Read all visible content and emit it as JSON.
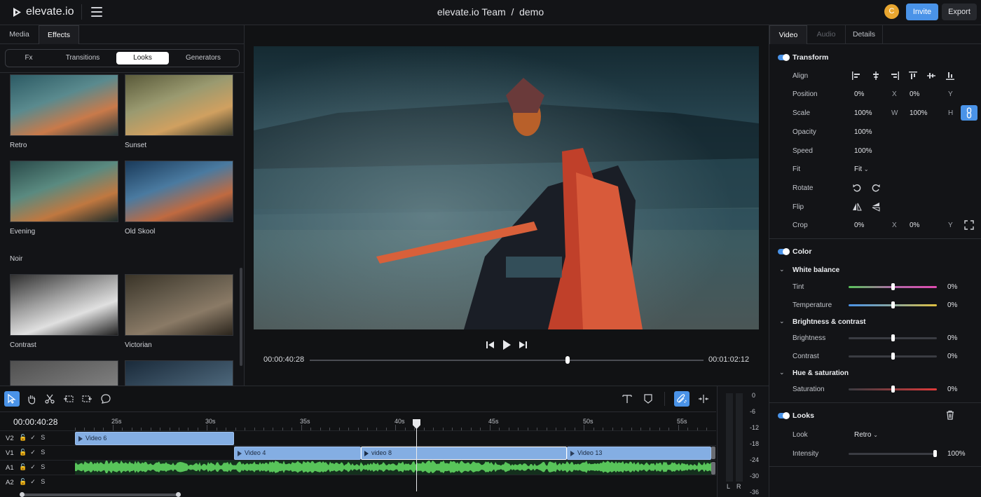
{
  "app": {
    "brand": "elevate.io",
    "project_path": "elevate.io Team  /  demo",
    "avatar_initial": "C",
    "invite_label": "Invite",
    "export_label": "Export"
  },
  "left_panel": {
    "tabs": [
      "Media",
      "Effects"
    ],
    "active_tab": "Effects",
    "subtabs": [
      "Fx",
      "Transitions",
      "Looks",
      "Generators"
    ],
    "active_subtab": "Looks",
    "section_noir": "Noir",
    "looks": [
      "Retro",
      "Sunset",
      "Evening",
      "Old Skool",
      "Contrast",
      "Victorian"
    ]
  },
  "player": {
    "current_time": "00:00:40:28",
    "duration": "00:01:02:12",
    "progress": 0.65
  },
  "right_panel": {
    "tabs": [
      "Video",
      "Audio",
      "Details"
    ],
    "active_tab": "Video",
    "transform": {
      "title": "Transform",
      "align_label": "Align",
      "position_label": "Position",
      "position_x": "0%",
      "x_axis": "X",
      "position_y": "0%",
      "y_axis": "Y",
      "scale_label": "Scale",
      "scale_w": "100%",
      "w_axis": "W",
      "scale_h": "100%",
      "h_axis": "H",
      "opacity_label": "Opacity",
      "opacity_value": "100%",
      "speed_label": "Speed",
      "speed_value": "100%",
      "fit_label": "Fit",
      "fit_value": "Fit",
      "rotate_label": "Rotate",
      "flip_label": "Flip",
      "crop_label": "Crop",
      "crop_x": "0%",
      "crop_y": "0%"
    },
    "color": {
      "title": "Color",
      "white_balance": "White balance",
      "tint_label": "Tint",
      "tint_value": "0%",
      "temperature_label": "Temperature",
      "temperature_value": "0%",
      "brightness_contrast": "Brightness & contrast",
      "brightness_label": "Brightness",
      "brightness_value": "0%",
      "contrast_label": "Contrast",
      "contrast_value": "0%",
      "hue_saturation": "Hue & saturation",
      "saturation_label": "Saturation",
      "saturation_value": "0%"
    },
    "looks": {
      "title": "Looks",
      "look_label": "Look",
      "look_value": "Retro",
      "intensity_label": "Intensity",
      "intensity_value": "100%",
      "intensity_level": 1.0
    }
  },
  "timeline": {
    "current_time": "00:00:40:28",
    "ruler": [
      "25s",
      "30s",
      "35s",
      "40s",
      "45s",
      "50s",
      "55s"
    ],
    "tracks": [
      {
        "name": "V2",
        "solo": "S"
      },
      {
        "name": "V1",
        "solo": "S"
      },
      {
        "name": "A1",
        "solo": "S"
      },
      {
        "name": "A2",
        "solo": "S"
      }
    ],
    "clips": {
      "v2": "Video 6",
      "v1a": "Video 4",
      "v1b": "video 8",
      "v1c": "Video 13"
    },
    "meter_db": [
      "0",
      "-6",
      "-12",
      "-18",
      "-24",
      "-30",
      "-36"
    ],
    "meter_channels": [
      "L",
      "R"
    ]
  },
  "colors": {
    "accent": "#4a93e8",
    "audio_wave": "#58c45a",
    "clip": "#84aee3"
  }
}
